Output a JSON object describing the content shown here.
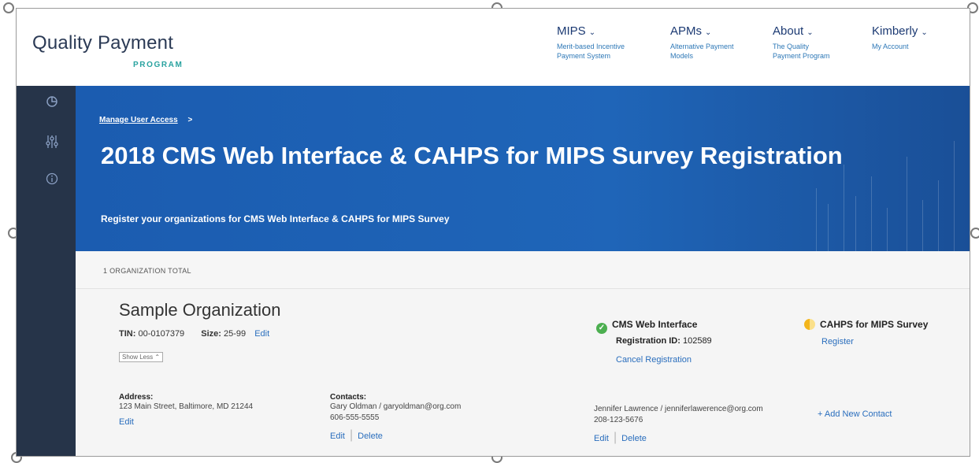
{
  "header": {
    "logo_main": "Quality Payment",
    "logo_sub": "PROGRAM",
    "nav": [
      {
        "title": "MIPS",
        "sub": [
          "Merit-based Incentive",
          "Payment System"
        ]
      },
      {
        "title": "APMs",
        "sub": [
          "Alternative Payment",
          "Models"
        ]
      },
      {
        "title": "About",
        "sub": [
          "The Quality",
          "Payment Program"
        ]
      },
      {
        "title": "Kimberly",
        "sub": [
          "My Account",
          ""
        ]
      }
    ]
  },
  "sidebar": {
    "icons": [
      "pie-chart-icon",
      "sliders-icon",
      "info-icon"
    ]
  },
  "hero": {
    "breadcrumb": "Manage User Access",
    "breadcrumb_sep": ">",
    "title": "2018 CMS Web Interface & CAHPS for MIPS Survey Registration",
    "subtitle": "Register your organizations for CMS Web Interface & CAHPS for MIPS Survey"
  },
  "summary": {
    "total": "1 ORGANIZATION TOTAL"
  },
  "organization": {
    "name": "Sample Organization",
    "tin_label": "TIN:",
    "tin_value": "00-0107379",
    "size_label": "Size:",
    "size_value": "25-99",
    "edit": "Edit",
    "show_less": "Show Less",
    "address_label": "Address:",
    "address_value": "123 Main Street, Baltimore, MD 21244",
    "address_edit": "Edit",
    "contacts_label": "Contacts:",
    "contacts": [
      {
        "name_email": "Gary Oldman / garyoldman@org.com",
        "phone": "606-555-5555",
        "edit": "Edit",
        "delete": "Delete"
      },
      {
        "name_email": "Jennifer Lawrence / jenniferlawerence@org.com",
        "phone": "208-123-5676",
        "edit": "Edit",
        "delete": "Delete"
      }
    ],
    "add_contact": "+ Add New Contact",
    "cms": {
      "title": "CMS Web Interface",
      "reg_label": "Registration ID:",
      "reg_value": "102589",
      "cancel": "Cancel Registration",
      "status_color": "#4caf50"
    },
    "cahps": {
      "title": "CAHPS for MIPS Survey",
      "register": "Register",
      "status_color": "#f3b51b"
    }
  }
}
